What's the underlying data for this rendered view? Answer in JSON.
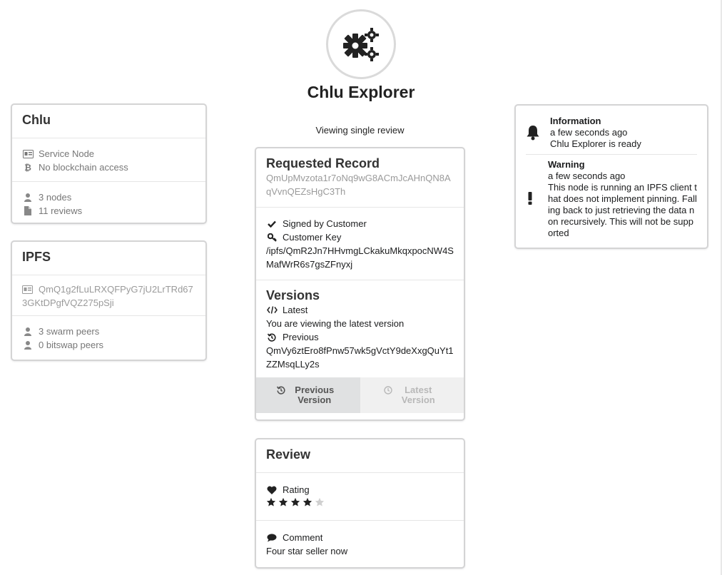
{
  "app": {
    "title": "Chlu Explorer",
    "subtitle": "Viewing single review"
  },
  "chlu_card": {
    "title": "Chlu",
    "node_type": "Service Node",
    "blockchain": "No blockchain access",
    "nodes": "3 nodes",
    "reviews": "11 reviews"
  },
  "ipfs_card": {
    "title": "IPFS",
    "node_id": "QmQ1g2fLuLRXQFPyG7jU2LrTRd673GKtDPgfVQZ275pSji",
    "swarm_peers": "3 swarm peers",
    "bitswap_peers": "0 bitswap peers"
  },
  "record_card": {
    "title": "Requested Record",
    "multihash": "QmUpMvzota1r7oNq9wG8ACmJcAHnQN8AqVvnQEZsHgC3Th",
    "signed_label": "Signed by Customer",
    "key_label": "Customer Key",
    "key_path": "/ipfs/QmR2Jn7HHvmgLCkakuMkqxpocNW4SMafWrR6s7gsZFnyxj",
    "versions_title": "Versions",
    "latest_label": "Latest",
    "latest_text": "You are viewing the latest version",
    "previous_label": "Previous",
    "previous_hash": "QmVy6ztEro8fPnw57wk5gVctY9deXxgQuYt1ZZMsqLLy2s",
    "prev_button": "Previous Version",
    "latest_button": "Latest Version"
  },
  "review_card": {
    "title": "Review",
    "rating_label": "Rating",
    "rating": 4,
    "rating_max": 5,
    "comment_label": "Comment",
    "comment": "Four star seller now"
  },
  "notifications": [
    {
      "type": "Information",
      "time": "a few seconds ago",
      "message": "Chlu Explorer is ready",
      "icon": "bell-icon"
    },
    {
      "type": "Warning",
      "time": "a few seconds ago",
      "message": "This node is running an IPFS client that does not implement pinning. Falling back to just retrieving the data non recursively. This will not be supported",
      "icon": "exclamation-icon"
    }
  ],
  "colors": {
    "star_on": "#222222",
    "star_off": "#d0d0d0",
    "muted": "#9a9a9a"
  }
}
